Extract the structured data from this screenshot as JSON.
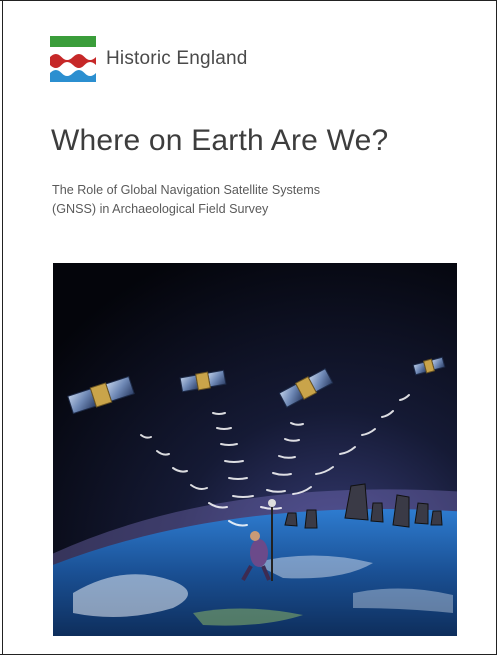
{
  "organization": {
    "name": "Historic England"
  },
  "document": {
    "title": "Where on Earth Are We?",
    "subtitle_line1": "The Role of Global Navigation Satellite Systems",
    "subtitle_line2": "(GNSS) in Archaeological Field Survey"
  },
  "colors": {
    "logo_green": "#3a9d3a",
    "logo_red": "#c62828",
    "logo_blue": "#2b8fd0",
    "text_dark": "#3d3d3d",
    "space": "#05070f",
    "earth_blue": "#1d5fa8"
  },
  "cover_image": {
    "subject": "illustration"
  }
}
